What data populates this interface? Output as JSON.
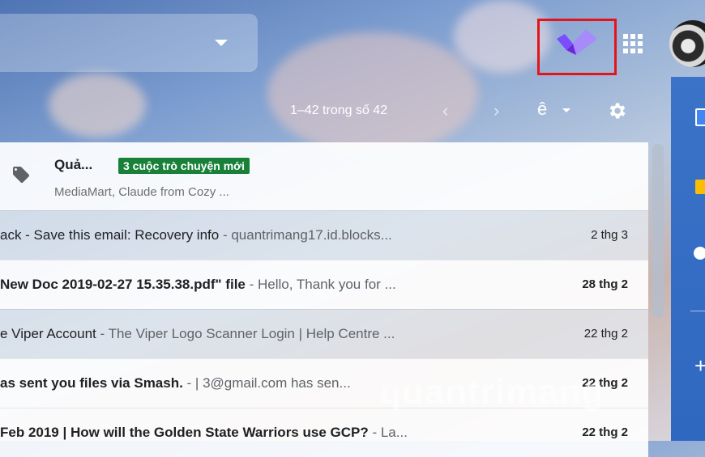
{
  "header": {
    "addon_icon": "check-logo-icon",
    "apps_icon": "apps-grid-icon",
    "avatar_icon": "account-avatar"
  },
  "toolbar": {
    "pagination": "1–42 trong số 42",
    "prev_icon": "chevron-left-icon",
    "next_icon": "chevron-right-icon",
    "input_tool_label": "ê",
    "settings_icon": "gear-icon"
  },
  "promotions": {
    "title": "Quả...",
    "badge": "3 cuộc trò chuyện mới",
    "senders": "MediaMart, Claude from Cozy ..."
  },
  "emails": [
    {
      "subject": "ack - Save this email: Recovery info",
      "snippet": " - quantrimang17.id.blocks...",
      "date": "2 thg 3",
      "unread": false
    },
    {
      "subject": "New Doc 2019-02-27 15.35.38.pdf\" file",
      "snippet": " - Hello, Thank you for ...",
      "date": "28 thg 2",
      "unread": true
    },
    {
      "subject": "e Viper Account",
      "snippet": " - The Viper Logo Scanner Login | Help Centre ...",
      "date": "22 thg 2",
      "unread": false
    },
    {
      "subject": "as sent you files via Smash.",
      "snippet": " - |                        3@gmail.com has sen...",
      "date": "22 thg 2",
      "unread": true
    },
    {
      "subject": "Feb 2019 | How will the Golden State Warriors use GCP?",
      "snippet": " - La...",
      "date": "22 thg 2",
      "unread": true
    }
  ],
  "watermark": "quantrimang",
  "colors": {
    "highlight_box": "#e3141a",
    "badge_green": "#188038",
    "addon_purple": "#8b5cf6"
  }
}
